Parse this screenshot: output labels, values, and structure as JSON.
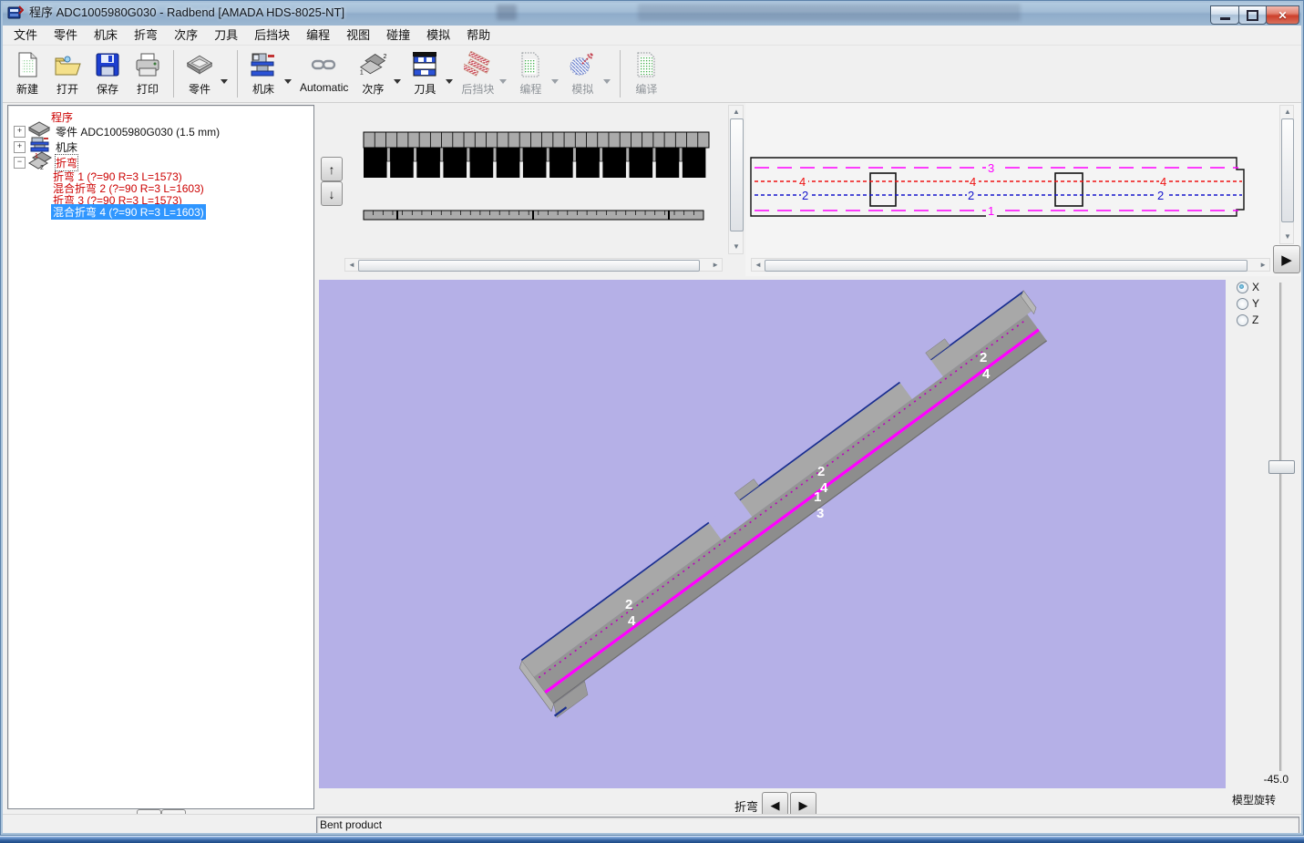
{
  "titlebar": {
    "title": "程序 ADC1005980G030 - Radbend [AMADA HDS-8025-NT]",
    "window_controls": [
      "minimize",
      "restore",
      "close"
    ]
  },
  "menubar": {
    "items": [
      "文件",
      "零件",
      "机床",
      "折弯",
      "次序",
      "刀具",
      "后挡块",
      "编程",
      "视图",
      "碰撞",
      "模拟",
      "帮助"
    ]
  },
  "toolbar": {
    "buttons": [
      {
        "label": "新建",
        "icon": "new-document-icon",
        "enabled": true,
        "dropdown": false
      },
      {
        "label": "打开",
        "icon": "open-folder-icon",
        "enabled": true,
        "dropdown": false
      },
      {
        "label": "保存",
        "icon": "save-floppy-icon",
        "enabled": true,
        "dropdown": false
      },
      {
        "label": "打印",
        "icon": "print-icon",
        "enabled": true,
        "dropdown": false
      },
      {
        "label": "零件",
        "icon": "part-icon",
        "enabled": true,
        "dropdown": true
      },
      {
        "label": "机床",
        "icon": "machine-icon",
        "enabled": true,
        "dropdown": true
      },
      {
        "label": "Automatic",
        "icon": "chain-link-icon",
        "enabled": true,
        "dropdown": false
      },
      {
        "label": "次序",
        "icon": "sequence-icon",
        "enabled": true,
        "dropdown": true
      },
      {
        "label": "刀具",
        "icon": "tools-icon",
        "enabled": true,
        "dropdown": true
      },
      {
        "label": "后挡块",
        "icon": "backgauge-icon",
        "enabled": false,
        "dropdown": true
      },
      {
        "label": "编程",
        "icon": "program-icon",
        "enabled": false,
        "dropdown": true
      },
      {
        "label": "模拟",
        "icon": "simulate-icon",
        "enabled": false,
        "dropdown": true
      },
      {
        "label": "编译",
        "icon": "compile-icon",
        "enabled": false,
        "dropdown": false
      }
    ]
  },
  "tree": {
    "root_label": "程序",
    "nodes": [
      {
        "label": "零件 ADC1005980G030 (1.5 mm)",
        "state": "collapsed",
        "icon": "part-icon"
      },
      {
        "label": "机床",
        "state": "collapsed",
        "icon": "machine-icon"
      },
      {
        "label": "折弯",
        "state": "expanded",
        "icon": "bend-icon",
        "focused": true
      }
    ],
    "bends": [
      {
        "label": "折弯 1 (?=90 R=3 L=1573)",
        "selected": false
      },
      {
        "label": "混合折弯 2 (?=90 R=3 L=1603)",
        "selected": false
      },
      {
        "label": "折弯 3 (?=90 R=3 L=1573)",
        "selected": false
      },
      {
        "label": "混合折弯 4 (?=90 R=3 L=1603)",
        "selected": true
      }
    ]
  },
  "tool_setup": {
    "holder_segments": 31,
    "punch_segments": 13,
    "die_ticks": 35,
    "die_section_dividers": 3
  },
  "flat_pattern": {
    "labels": [
      "3",
      "4",
      "4",
      "4",
      "2",
      "2",
      "2",
      "1"
    ],
    "line_colors": {
      "line1": "#ff00ff",
      "line2": "#1414cc",
      "line3": "#ff00ff",
      "line4": "#ee1111"
    }
  },
  "viewport": {
    "background_color": "#b5b0e7",
    "part_labels": [
      "2",
      "4",
      "2",
      "4",
      "1",
      "3",
      "2",
      "4"
    ],
    "axis_options": [
      "X",
      "Y",
      "Z"
    ],
    "selected_axis": "X",
    "rotation_value": "-45.0",
    "rotation_label": "模型旋转"
  },
  "bend_nav": {
    "label": "折弯"
  },
  "status_bar": {
    "text": "Bent product"
  }
}
